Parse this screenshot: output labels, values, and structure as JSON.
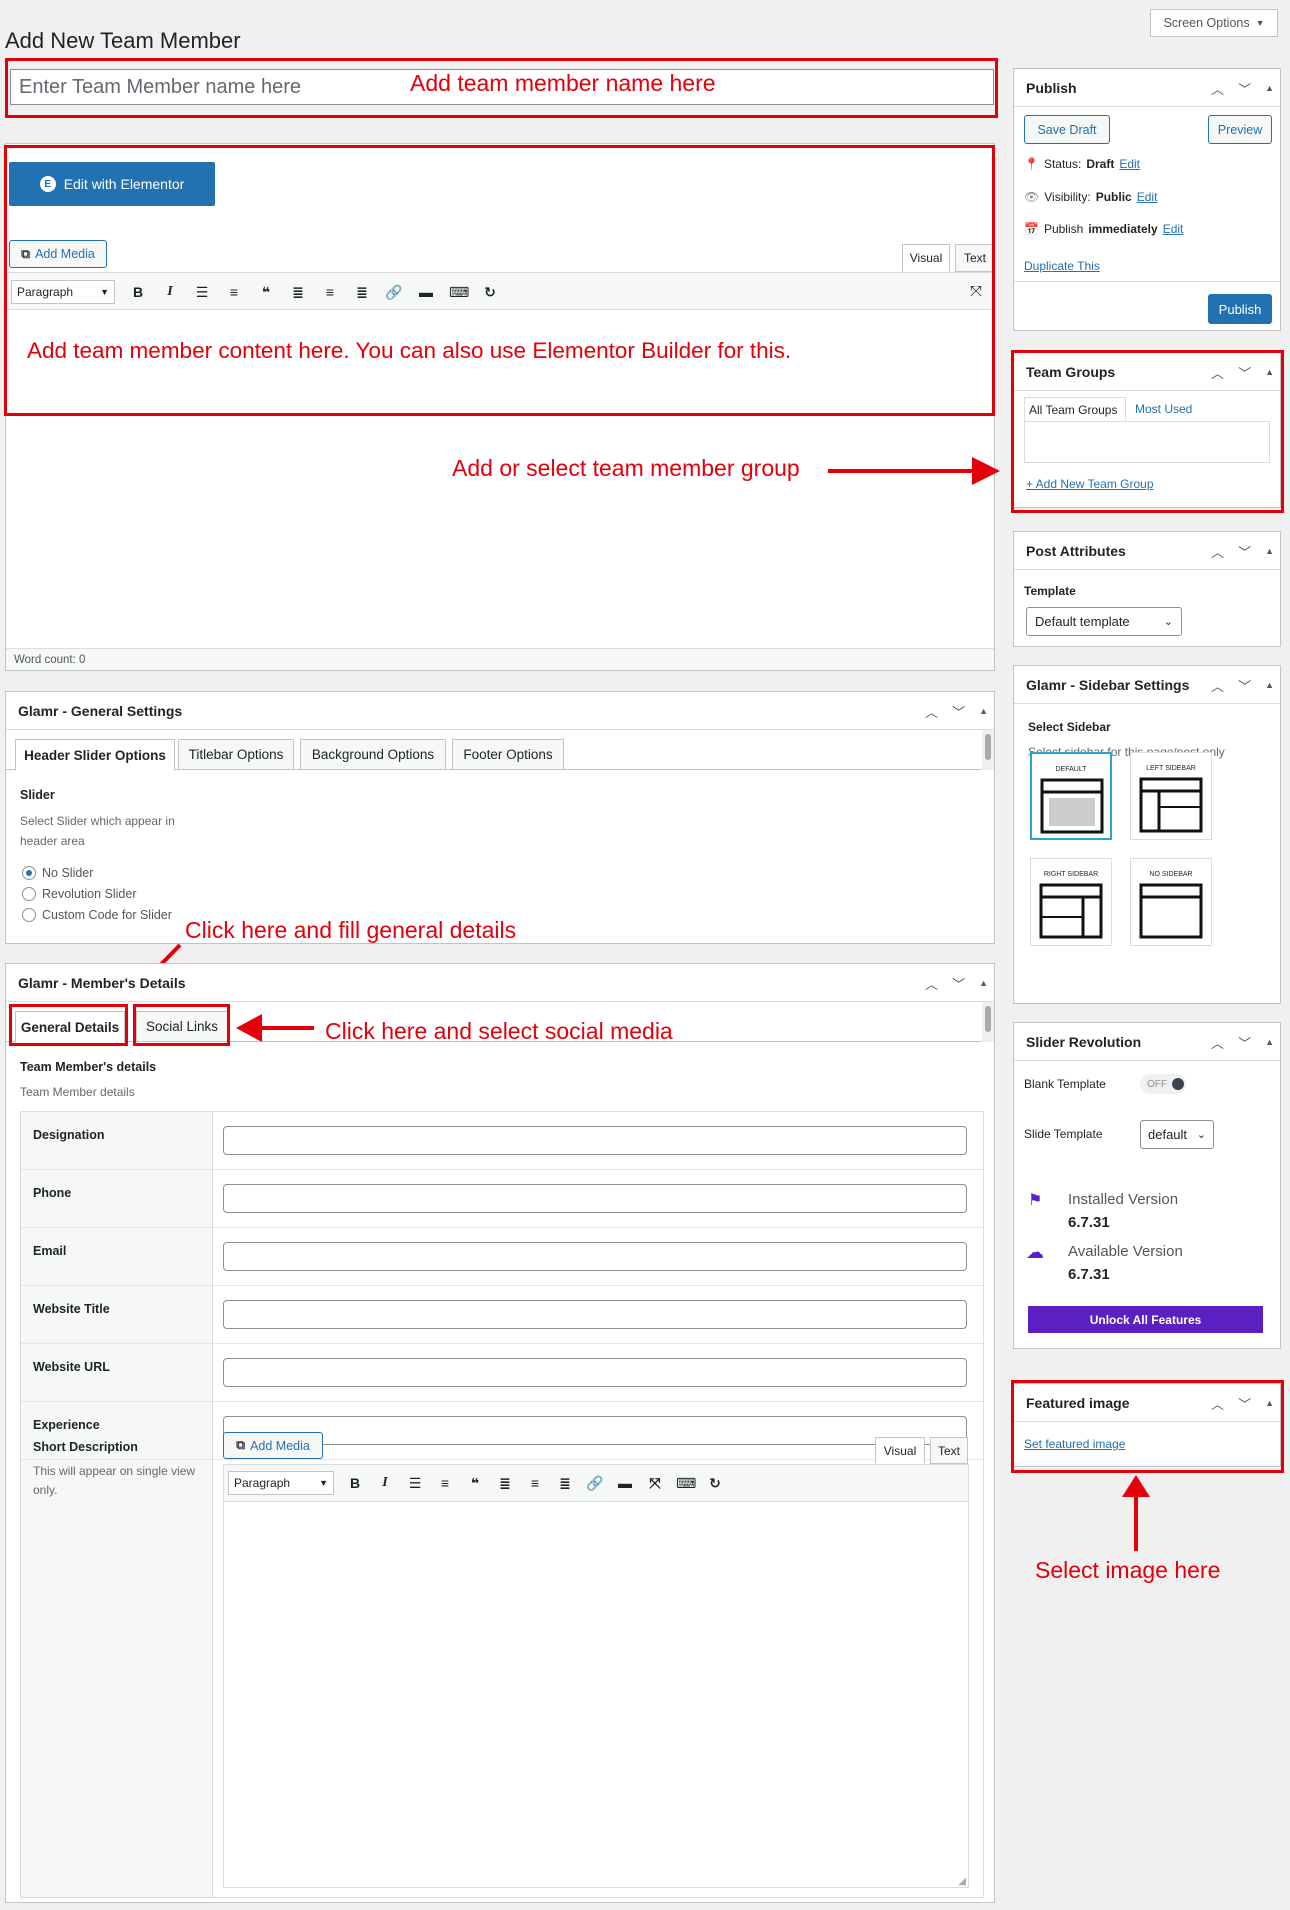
{
  "page_title": "Add New Team Member",
  "screen_options": "Screen Options",
  "title_placeholder": "Enter Team Member name here",
  "elementor_button": "Edit with Elementor",
  "editor": {
    "add_media": "Add Media",
    "visual_tab": "Visual",
    "text_tab": "Text",
    "format_select": "Paragraph",
    "word_count": "Word count: 0"
  },
  "annotations": {
    "name": "Add team member name here",
    "content": "Add team member content here. You can also use Elementor Builder for this.",
    "group": "Add or select team member group",
    "general": "Click here and fill general details",
    "social": "Click here and select social media",
    "image": "Select image here"
  },
  "publish": {
    "title": "Publish",
    "save_draft": "Save Draft",
    "preview": "Preview",
    "status_label": "Status:",
    "status_value": "Draft",
    "visibility_label": "Visibility:",
    "visibility_value": "Public",
    "publish_label": "Publish",
    "publish_value": "immediately",
    "edit": "Edit",
    "duplicate": "Duplicate This",
    "publish_button": "Publish"
  },
  "team_groups": {
    "title": "Team Groups",
    "tab_all": "All Team Groups",
    "tab_most": "Most Used",
    "add_new": "+ Add New Team Group"
  },
  "post_attributes": {
    "title": "Post Attributes",
    "template_label": "Template",
    "template_value": "Default template"
  },
  "sidebar_settings": {
    "title": "Glamr - Sidebar Settings",
    "select_label": "Select Sidebar",
    "select_desc": "Select sidebar for this page/post only",
    "options": [
      "DEFAULT",
      "LEFT SIDEBAR",
      "RIGHT SIDEBAR",
      "NO SIDEBAR"
    ]
  },
  "slider_revolution": {
    "title": "Slider Revolution",
    "blank_template": "Blank Template",
    "toggle": "OFF",
    "slide_template": "Slide Template",
    "slide_value": "default",
    "installed_label": "Installed Version",
    "installed_value": "6.7.31",
    "available_label": "Available Version",
    "available_value": "6.7.31",
    "unlock": "Unlock All Features"
  },
  "featured_image": {
    "title": "Featured image",
    "set": "Set featured image"
  },
  "general_settings": {
    "title": "Glamr - General Settings",
    "tabs": [
      "Header Slider Options",
      "Titlebar Options",
      "Background Options",
      "Footer Options"
    ],
    "slider_label": "Slider",
    "slider_desc": "Select Slider which appear in header area",
    "options": [
      "No Slider",
      "Revolution Slider",
      "Custom Code for Slider"
    ]
  },
  "member_details": {
    "title": "Glamr - Member's Details",
    "tabs": [
      "General Details",
      "Social Links"
    ],
    "heading": "Team Member's details",
    "subheading": "Team Member details",
    "fields": [
      "Designation",
      "Phone",
      "Email",
      "Website Title",
      "Website URL",
      "Experience"
    ],
    "short_desc_label": "Short Description",
    "short_desc_note": "This will appear on single view only."
  },
  "colors": {
    "annotation_red": "#e3000b",
    "wp_blue": "#2271b1",
    "unlock_purple": "#5c1fc4"
  }
}
